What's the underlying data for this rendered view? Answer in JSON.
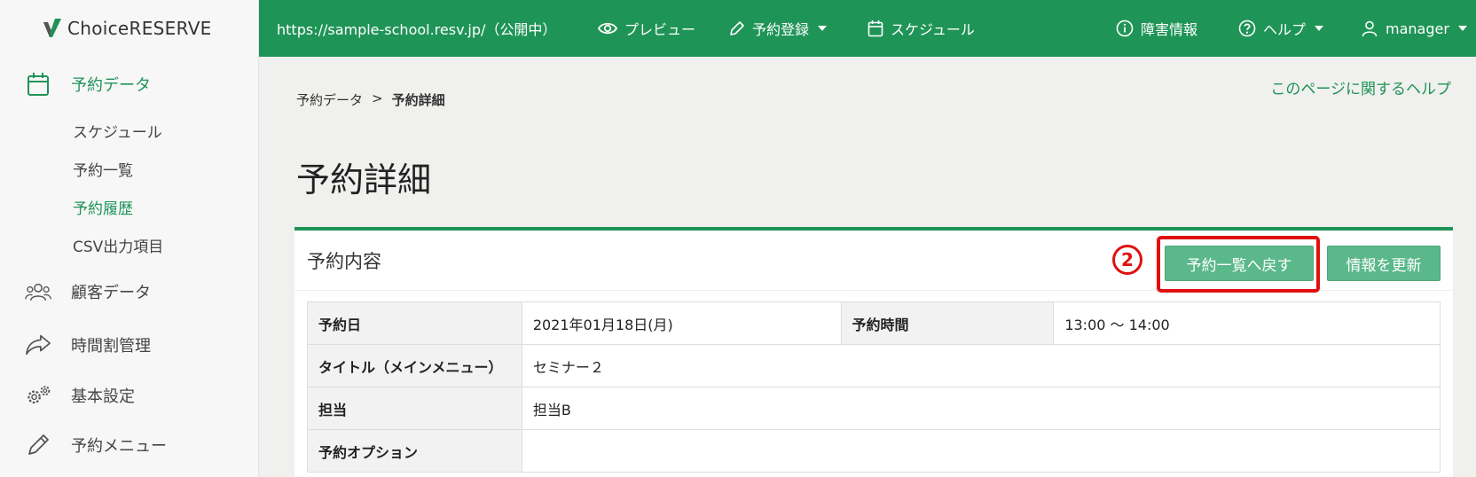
{
  "app": {
    "logo_text": "ChoiceRESERVE"
  },
  "topbar": {
    "url_text": "https://sample-school.resv.jp/（公開中）",
    "preview": "プレビュー",
    "register": "予約登録",
    "schedule": "スケジュール",
    "outage": "障害情報",
    "help": "ヘルプ",
    "user": "manager"
  },
  "sidebar": {
    "reservation_data": "予約データ",
    "sub": [
      "スケジュール",
      "予約一覧",
      "予約履歴",
      "CSV出力項目"
    ],
    "customer_data": "顧客データ",
    "timetable": "時間割管理",
    "basic_settings": "基本設定",
    "reservation_menu": "予約メニュー"
  },
  "breadcrumb": {
    "parent": "予約データ",
    "sep": ">",
    "current": "予約詳細"
  },
  "help_link": "このページに関するヘルプ",
  "page_title": "予約詳細",
  "panel": {
    "title": "予約内容",
    "annotation": "2",
    "back_button": "予約一覧へ戻す",
    "update_button": "情報を更新"
  },
  "details": {
    "date_label": "予約日",
    "date_value": "2021年01月18日(月)",
    "time_label": "予約時間",
    "time_value": "13:00 〜 14:00",
    "title_label": "タイトル（メインメニュー）",
    "title_value": "セミナー２",
    "staff_label": "担当",
    "staff_value": "担当B",
    "option_label": "予約オプション",
    "option_value": ""
  },
  "colors": {
    "brand": "#1f9457",
    "annotation": "#e01010",
    "button": "#5bb88a"
  }
}
